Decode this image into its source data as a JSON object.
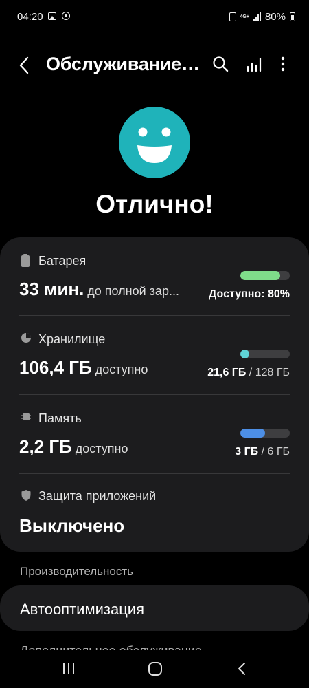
{
  "status_bar": {
    "time": "04:20",
    "network": "4G+",
    "battery_text": "80%"
  },
  "app_bar": {
    "title": "Обслуживание устройства",
    "icons": [
      "back-icon",
      "search-icon",
      "chart-icon",
      "more-vertical-icon"
    ]
  },
  "status": {
    "face_color": "#1fb3ba",
    "title": "Отлично!"
  },
  "items": [
    {
      "label": "Батарея",
      "value": "33 мин.",
      "suffix": "до полной зар...",
      "right_primary": "Доступно: 80%",
      "right_secondary": "",
      "fill_percent": 80,
      "bar_color": "#7fdc8a",
      "icon": "battery-icon"
    },
    {
      "label": "Хранилище",
      "value": "106,4 ГБ",
      "suffix": "доступно",
      "right_primary": "21,6 ГБ",
      "right_secondary": " / 128 ГБ",
      "fill_percent": 17,
      "bar_color": "#5fd3d6",
      "icon": "pie-chart-icon"
    },
    {
      "label": "Память",
      "value": "2,2 ГБ",
      "suffix": "доступно",
      "right_primary": "3 ГБ",
      "right_secondary": " / 6 ГБ",
      "fill_percent": 50,
      "bar_color": "#4d8fe6",
      "icon": "memory-chip-icon"
    },
    {
      "label": "Защита приложений",
      "value": "Выключено",
      "icon": "shield-icon"
    }
  ],
  "section": {
    "header": "Производительность",
    "auto_label": "Автооптимизация",
    "next_label": "Дополнительное обслуживание"
  },
  "nav": {
    "icons": [
      "recent-apps-icon",
      "home-icon",
      "nav-back-icon"
    ]
  }
}
